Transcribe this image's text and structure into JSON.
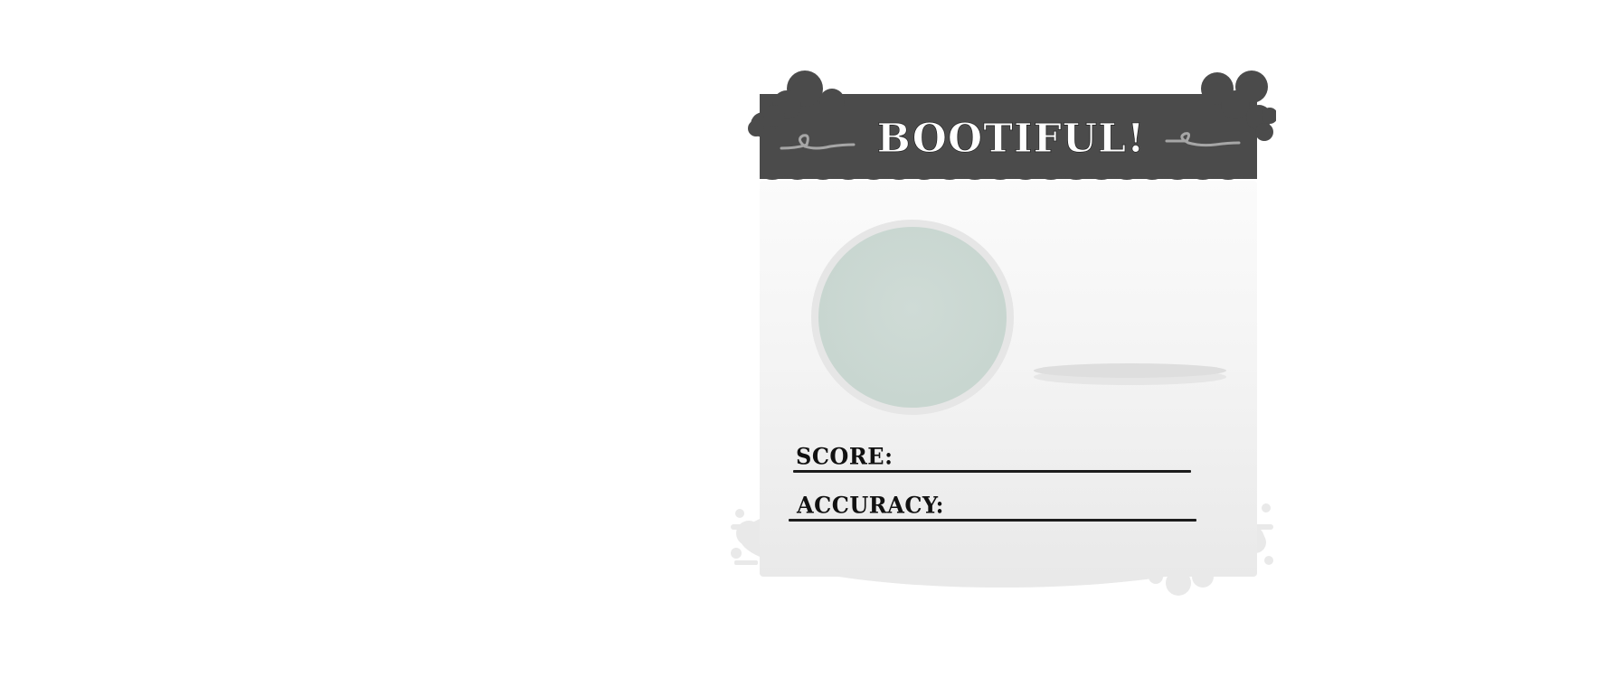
{
  "results": {
    "title": "BOOTIFUL!",
    "score_label": "SCORE:",
    "score_value": "",
    "accuracy_label": "ACCURACY:",
    "accuracy_value": ""
  },
  "colors": {
    "banner": "#4b4b4b",
    "avatar": "#c8d6d0",
    "ink": "#111111"
  },
  "icons": {
    "left_flourish": "curl-flourish-icon",
    "right_flourish": "curl-flourish-icon"
  }
}
